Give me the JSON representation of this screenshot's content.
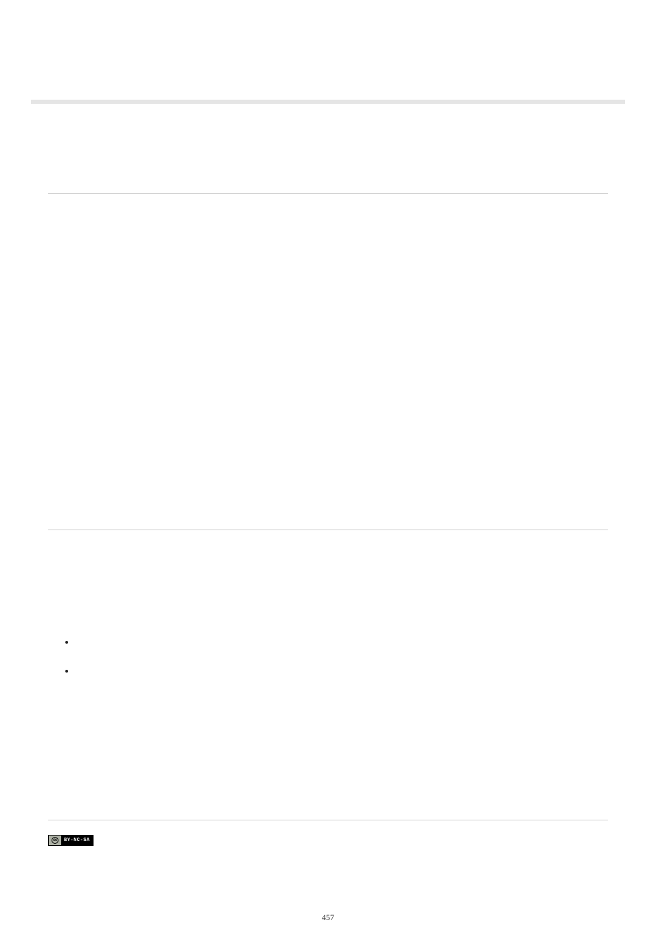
{
  "page_number": "457",
  "cc_badge": {
    "cc_text": "cc",
    "license_text": "BY-NC-SA"
  },
  "bullets": [
    {
      "text": ""
    },
    {
      "text": ""
    }
  ]
}
